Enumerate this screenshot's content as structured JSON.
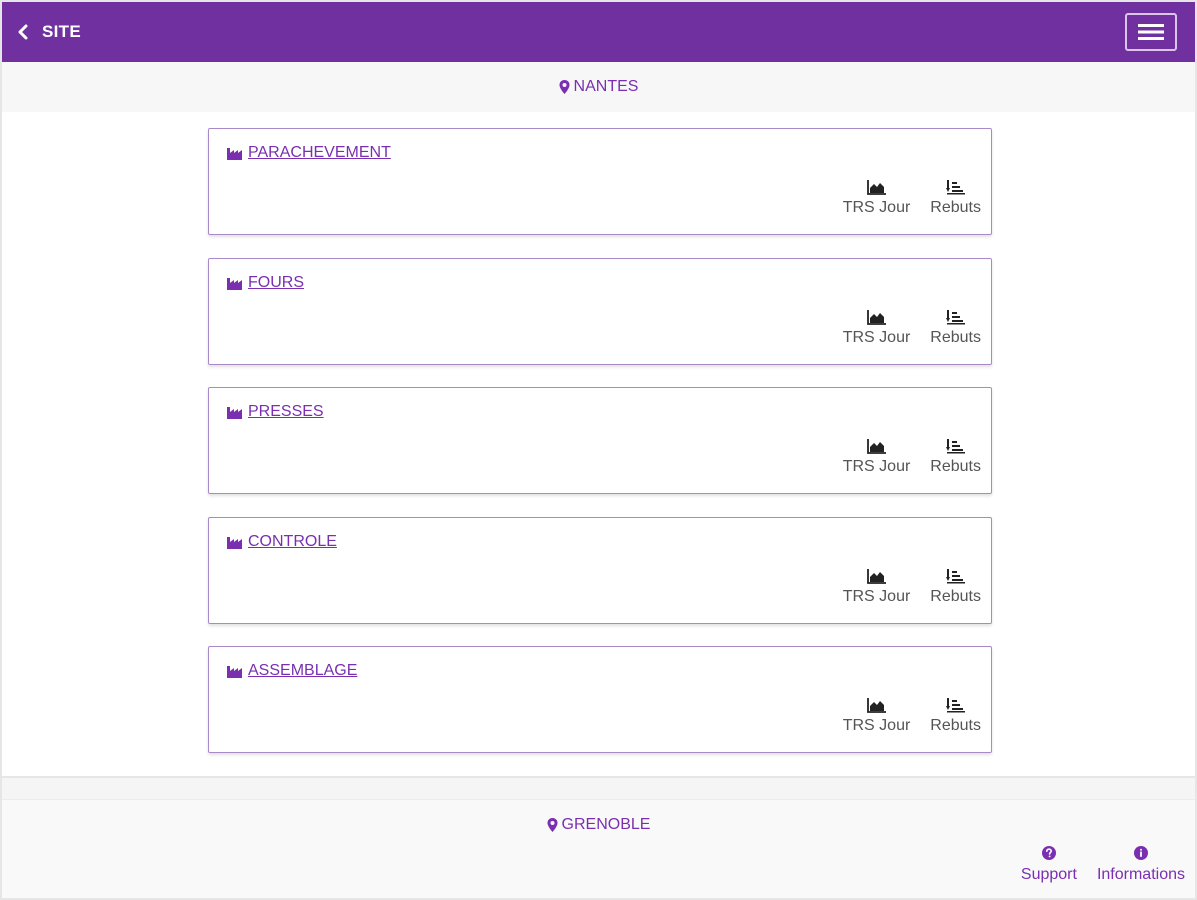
{
  "app_bar": {
    "back_label": "SITE",
    "back_icon": "chevron-left-icon",
    "menu_icon": "hamburger-menu-icon"
  },
  "colors": {
    "primary": "#7030a0",
    "link": "#7a2fb0"
  },
  "sites": [
    {
      "name": "NANTES",
      "workshops": [
        {
          "name": "PARACHEVEMENT",
          "actions": [
            "TRS Jour",
            "Rebuts"
          ]
        },
        {
          "name": "FOURS",
          "actions": [
            "TRS Jour",
            "Rebuts"
          ]
        },
        {
          "name": "PRESSES",
          "actions": [
            "TRS Jour",
            "Rebuts"
          ]
        },
        {
          "name": "CONTROLE",
          "actions": [
            "TRS Jour",
            "Rebuts"
          ]
        },
        {
          "name": "ASSEMBLAGE",
          "actions": [
            "TRS Jour",
            "Rebuts"
          ]
        }
      ]
    },
    {
      "name": "GRENOBLE",
      "workshops": []
    }
  ],
  "footer": {
    "support_label": "Support",
    "informations_label": "Informations"
  }
}
